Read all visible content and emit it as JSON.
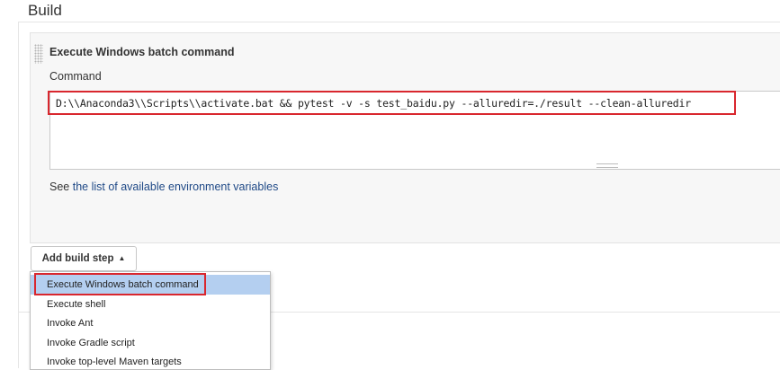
{
  "section": {
    "title": "Build"
  },
  "build_step": {
    "title": "Execute Windows batch command",
    "field_label": "Command",
    "command": "D:\\\\Anaconda3\\\\Scripts\\\\activate.bat && pytest -v -s test_baidu.py --alluredir=./result --clean-alluredir",
    "help_prefix": "See ",
    "help_link": "the list of available environment variables"
  },
  "add_button": {
    "label": "Add build step"
  },
  "menu": {
    "items": [
      {
        "label": "Execute Windows batch command",
        "selected": true
      },
      {
        "label": "Execute shell",
        "selected": false
      },
      {
        "label": "Invoke Ant",
        "selected": false
      },
      {
        "label": "Invoke Gradle script",
        "selected": false
      },
      {
        "label": "Invoke top-level Maven targets",
        "selected": false
      }
    ]
  },
  "colors": {
    "highlight": "#d9272e",
    "link": "#204a87",
    "menu_selected_bg": "#b4cff0",
    "panel_bg": "#f7f7f7"
  },
  "icons": {
    "drag_handle": "drag-handle-icon",
    "caret": "caret-up-icon"
  }
}
